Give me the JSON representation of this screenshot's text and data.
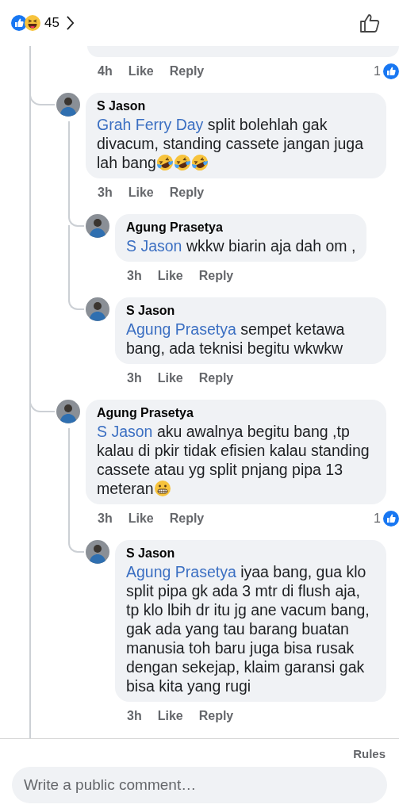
{
  "header": {
    "reaction_count": "45"
  },
  "comments": [
    {
      "time": "4h",
      "like": "Like",
      "reply": "Reply",
      "likes": "1"
    },
    {
      "author": "S Jason",
      "mention": "Grah Ferry Day",
      "text": "split bolehlah gak divacum, standing cassete jangan juga lah bang",
      "emojis": [
        {
          "kind": "rofl"
        },
        {
          "kind": "rofl"
        },
        {
          "kind": "rofl"
        }
      ],
      "time": "3h",
      "like": "Like",
      "reply": "Reply",
      "children": [
        {
          "author": "Agung Prasetya",
          "mention": "S Jason",
          "text": "wkkw biarin aja dah om ,",
          "time": "3h",
          "like": "Like",
          "reply": "Reply"
        },
        {
          "author": "S Jason",
          "mention": "Agung Prasetya",
          "text": "sempet ketawa bang, ada teknisi begitu wkwkw",
          "time": "3h",
          "like": "Like",
          "reply": "Reply"
        }
      ]
    },
    {
      "author": "Agung Prasetya",
      "mention": "S Jason",
      "text": "aku awalnya begitu bang ,tp kalau di pkir tidak efisien kalau standing cassete atau yg split pnjang pipa 13 meteran",
      "emojis": [
        {
          "kind": "grimace"
        }
      ],
      "time": "3h",
      "like": "Like",
      "reply": "Reply",
      "likes": "1",
      "children": [
        {
          "author": "S Jason",
          "mention": "Agung Prasetya",
          "text": "iyaa bang, gua klo split pipa gk ada 3 mtr di flush aja, tp klo lbih dr itu jg ane vacum bang, gak ada yang tau barang buatan manusia toh baru juga bisa rusak dengan sekejap, klaim garansi gak bisa kita yang rugi",
          "time": "3h",
          "like": "Like",
          "reply": "Reply"
        }
      ]
    }
  ],
  "footer": {
    "rules": "Rules",
    "placeholder": "Write a public comment…"
  }
}
